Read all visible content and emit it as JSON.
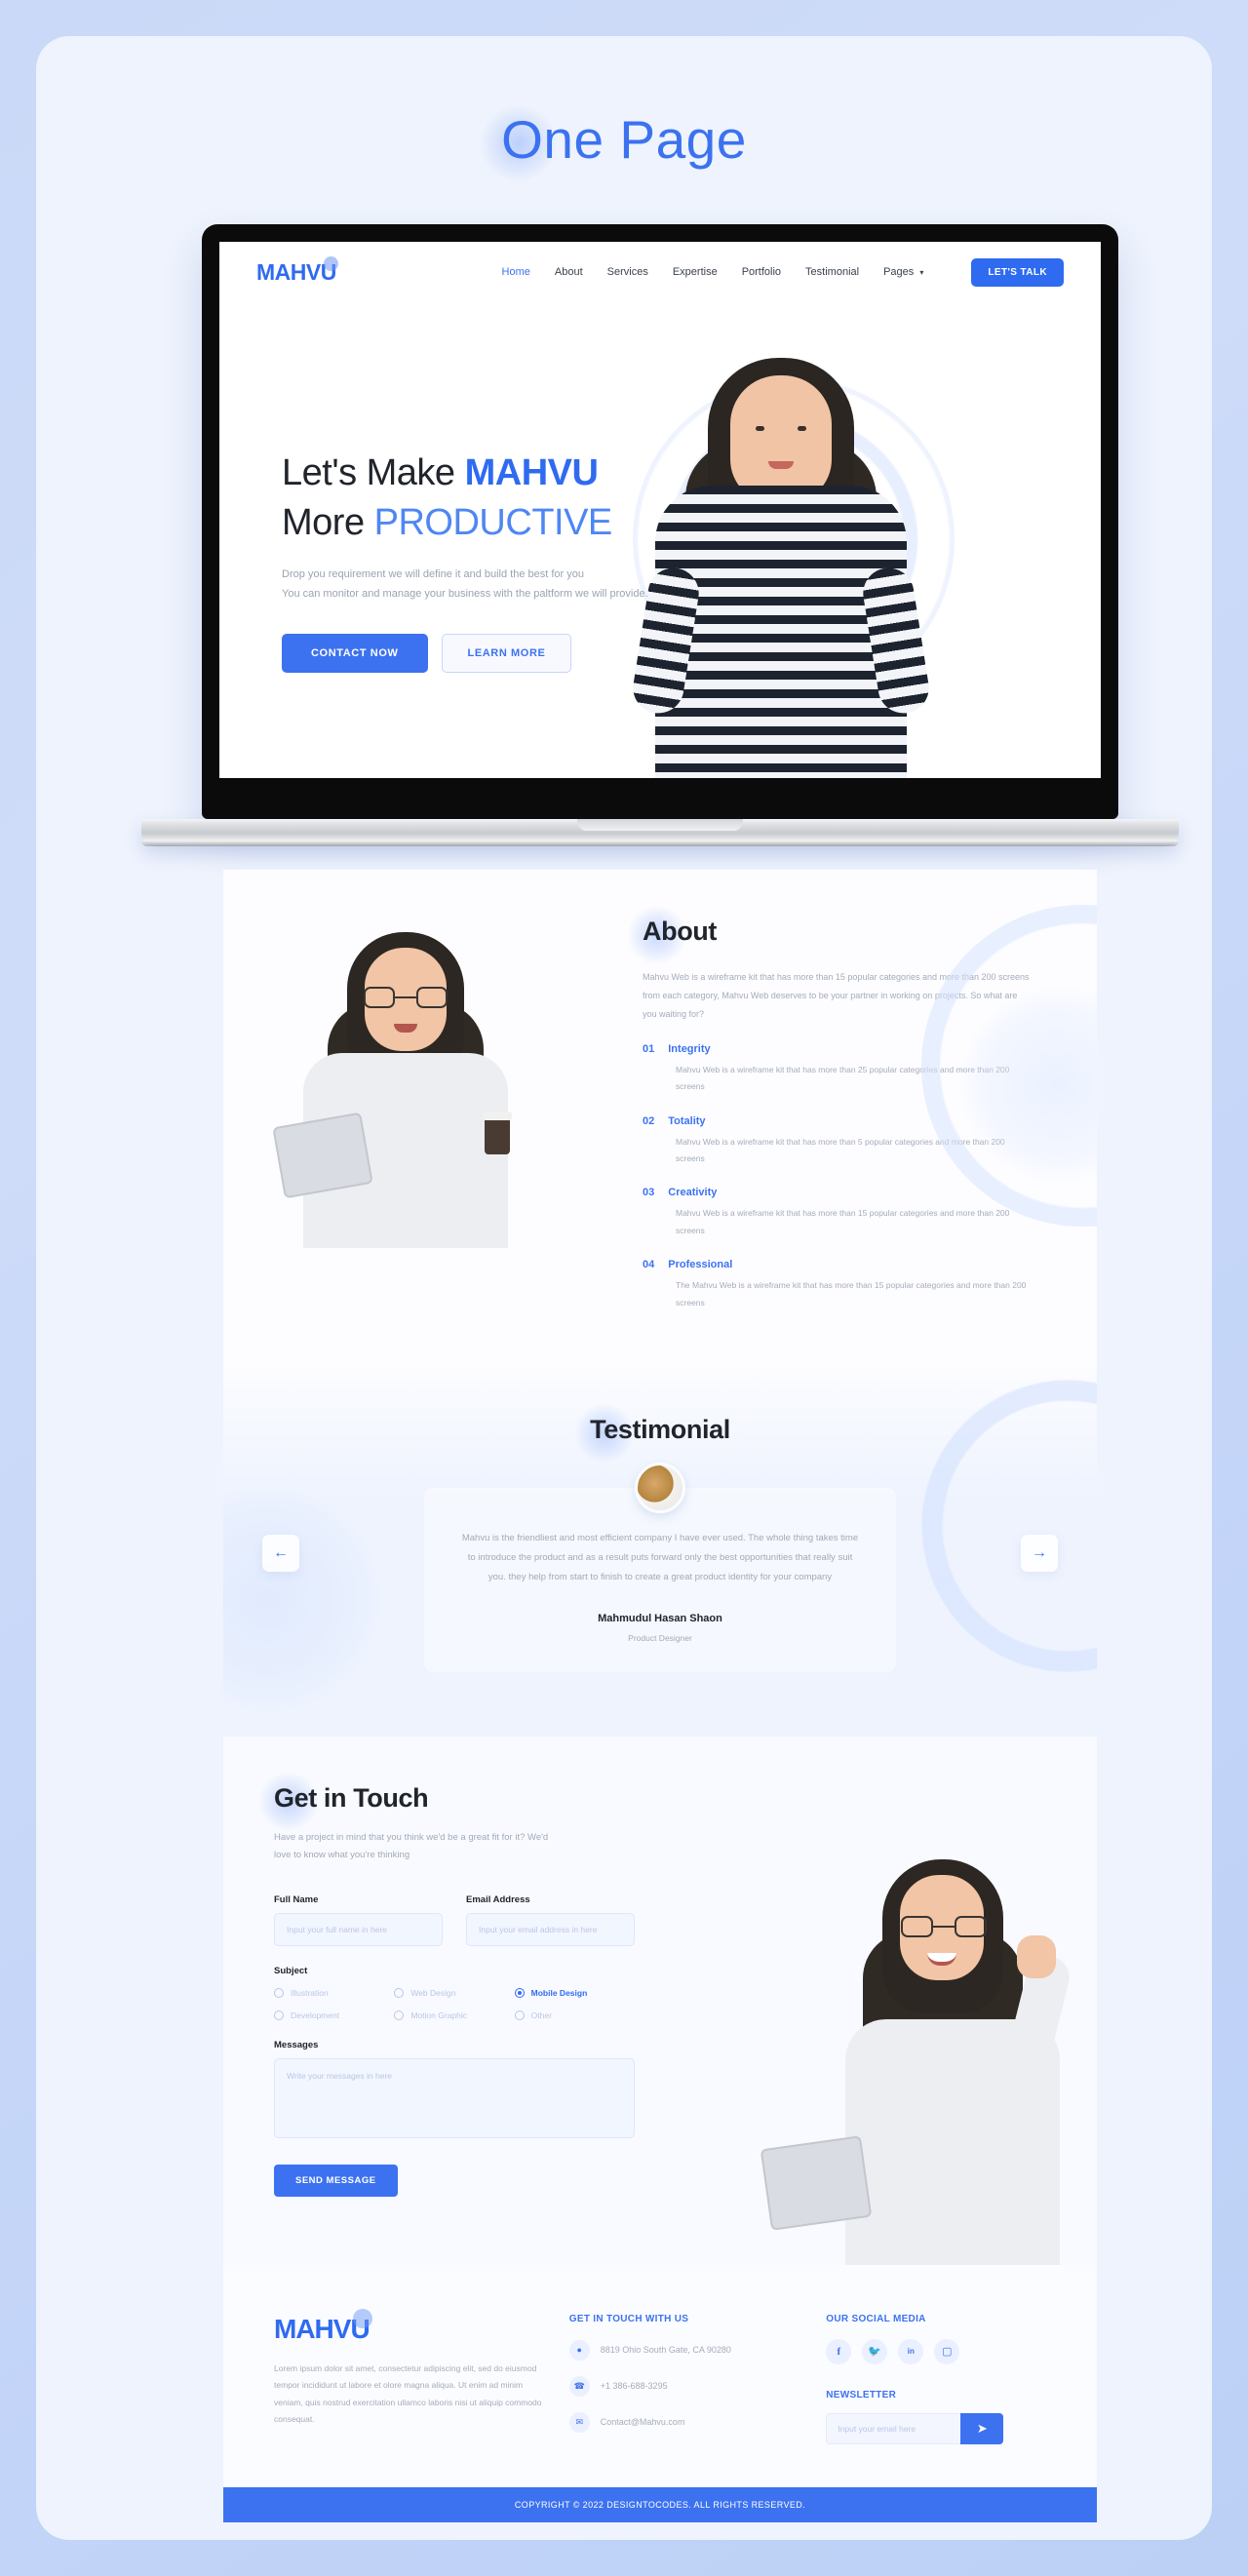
{
  "page_title": "One Page",
  "nav": {
    "logo": "MAHVU",
    "links": [
      {
        "label": "Home",
        "active": true
      },
      {
        "label": "About",
        "active": false
      },
      {
        "label": "Services",
        "active": false
      },
      {
        "label": "Expertise",
        "active": false
      },
      {
        "label": "Portfolio",
        "active": false
      },
      {
        "label": "Testimonial",
        "active": false
      },
      {
        "label": "Pages",
        "active": false,
        "caret": "⌵"
      }
    ],
    "cta": "LET'S TALK"
  },
  "hero": {
    "line1_plain": "Let's Make ",
    "line1_bold": "MAHVU",
    "line2_plain": "More ",
    "line2_light": "PRODUCTIVE",
    "sub_line1": "Drop you requirement we will define it and build the best for you",
    "sub_line2": "You can monitor and manage your business with the paltform we will provide.",
    "btn_primary": "CONTACT NOW",
    "btn_secondary": "LEARN MORE"
  },
  "about": {
    "title": "About",
    "description": "Mahvu Web is a wireframe kit that has more than 15 popular categories and more than 200 screens from each category, Mahvu Web deserves to be your partner in working on projects. So what are you waiting for?",
    "features": [
      {
        "num": "01",
        "title": "Integrity",
        "body": "Mahvu Web is a wireframe kit that has more than 25 popular categories and more than 200 screens"
      },
      {
        "num": "02",
        "title": "Totality",
        "body": "Mahvu Web is a wireframe kit that has more than 5 popular categories and more than 200 screens"
      },
      {
        "num": "03",
        "title": "Creativity",
        "body": "Mahvu Web is a wireframe kit that has more than 15 popular categories and more than 200 screens"
      },
      {
        "num": "04",
        "title": "Professional",
        "body": "The Mahvu Web is a wireframe kit that has more than 15 popular categories and more than 200 screens"
      }
    ]
  },
  "testimonial": {
    "title": "Testimonial",
    "quote": "Mahvu is the friendliest and most efficient company I have ever used. The whole thing takes time to introduce the product and as a result puts forward only the best opportunities that really suit you. they help from start to finish to create a great product identity for your company",
    "name": "Mahmudul Hasan Shaon",
    "role": "Product Designer",
    "prev_icon": "←",
    "next_icon": "→"
  },
  "contact": {
    "title": "Get in Touch",
    "subtitle": "Have a project in mind that you think we'd be a great fit for it? We'd love to know what you're thinking",
    "full_name_label": "Full Name",
    "full_name_placeholder": "Input your full name in here",
    "email_label": "Email Address",
    "email_placeholder": "Input your email address in here",
    "subject_label": "Subject",
    "subjects": [
      {
        "label": "Illustration",
        "selected": false
      },
      {
        "label": "Web Design",
        "selected": false
      },
      {
        "label": "Mobile Design",
        "selected": true
      },
      {
        "label": "Development",
        "selected": false
      },
      {
        "label": "Motion Graphic",
        "selected": false
      },
      {
        "label": "Other",
        "selected": false
      }
    ],
    "messages_label": "Messages",
    "messages_placeholder": "Write your messages in here",
    "send_label": "SEND MESSAGE"
  },
  "footer": {
    "logo": "MAHVU",
    "description": "Lorem ipsum dolor sit amet, consectetur adipiscing elit, sed do eiusmod tempor incididunt ut labore et olore magna aliqua. Ut enim ad minim veniam, quis nostrud exercitation ullamco laboris nisi ut aliquip commodo consequat.",
    "contact_heading": "GET IN TOUCH WITH US",
    "address": "8819 Ohio South Gate, CA 90280",
    "phone": "+1 386-688-3295",
    "email": "Contact@Mahvu.com",
    "social_heading": "OUR SOCIAL MEDIA",
    "socials": [
      "facebook-icon",
      "twitter-icon",
      "linkedin-icon",
      "instagram-icon"
    ],
    "newsletter_heading": "NEWSLETTER",
    "newsletter_placeholder": "Input your email here",
    "newsletter_btn_icon": "➤",
    "copyright": "COPYRIGHT © 2022 DESIGNTOCODES. ALL RIGHTS RESERVED."
  },
  "colors": {
    "accent": "#3c72f0",
    "accent_dark": "#2f6bf0",
    "page_bg": "#eef3fd",
    "outer_bg": "#c9d9f7",
    "muted_text": "#a4acba",
    "heading": "#20242c"
  }
}
